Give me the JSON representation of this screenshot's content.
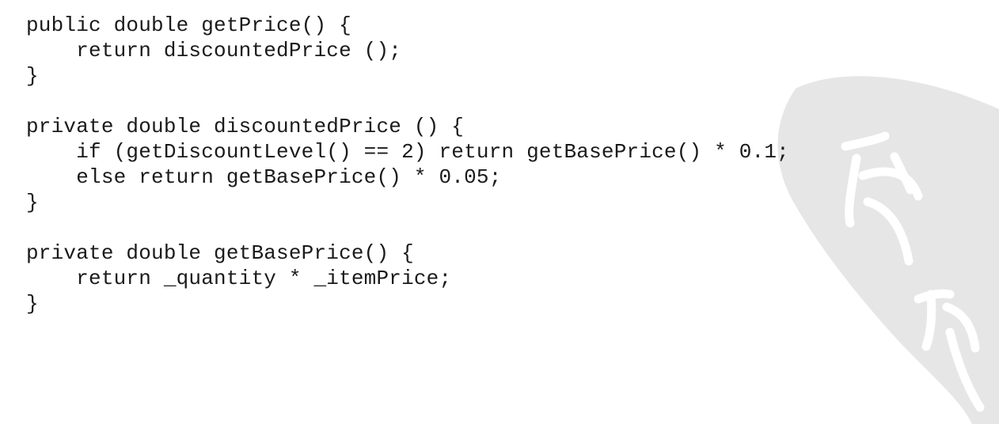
{
  "code_listing": {
    "lines": [
      "public double getPrice() {",
      "    return discountedPrice ();",
      "}",
      "",
      "private double discountedPrice () {",
      "    if (getDiscountLevel() == 2) return getBasePrice() * 0.1;",
      "    else return getBasePrice() * 0.05;",
      "}",
      "",
      "private double getBasePrice() {",
      "    return _quantity * _itemPrice;",
      "}"
    ]
  },
  "colors": {
    "text": "#1a1a1a",
    "background": "#ffffff",
    "watermark_fill": "#e6e6e6",
    "watermark_glyph": "#ffffff"
  }
}
